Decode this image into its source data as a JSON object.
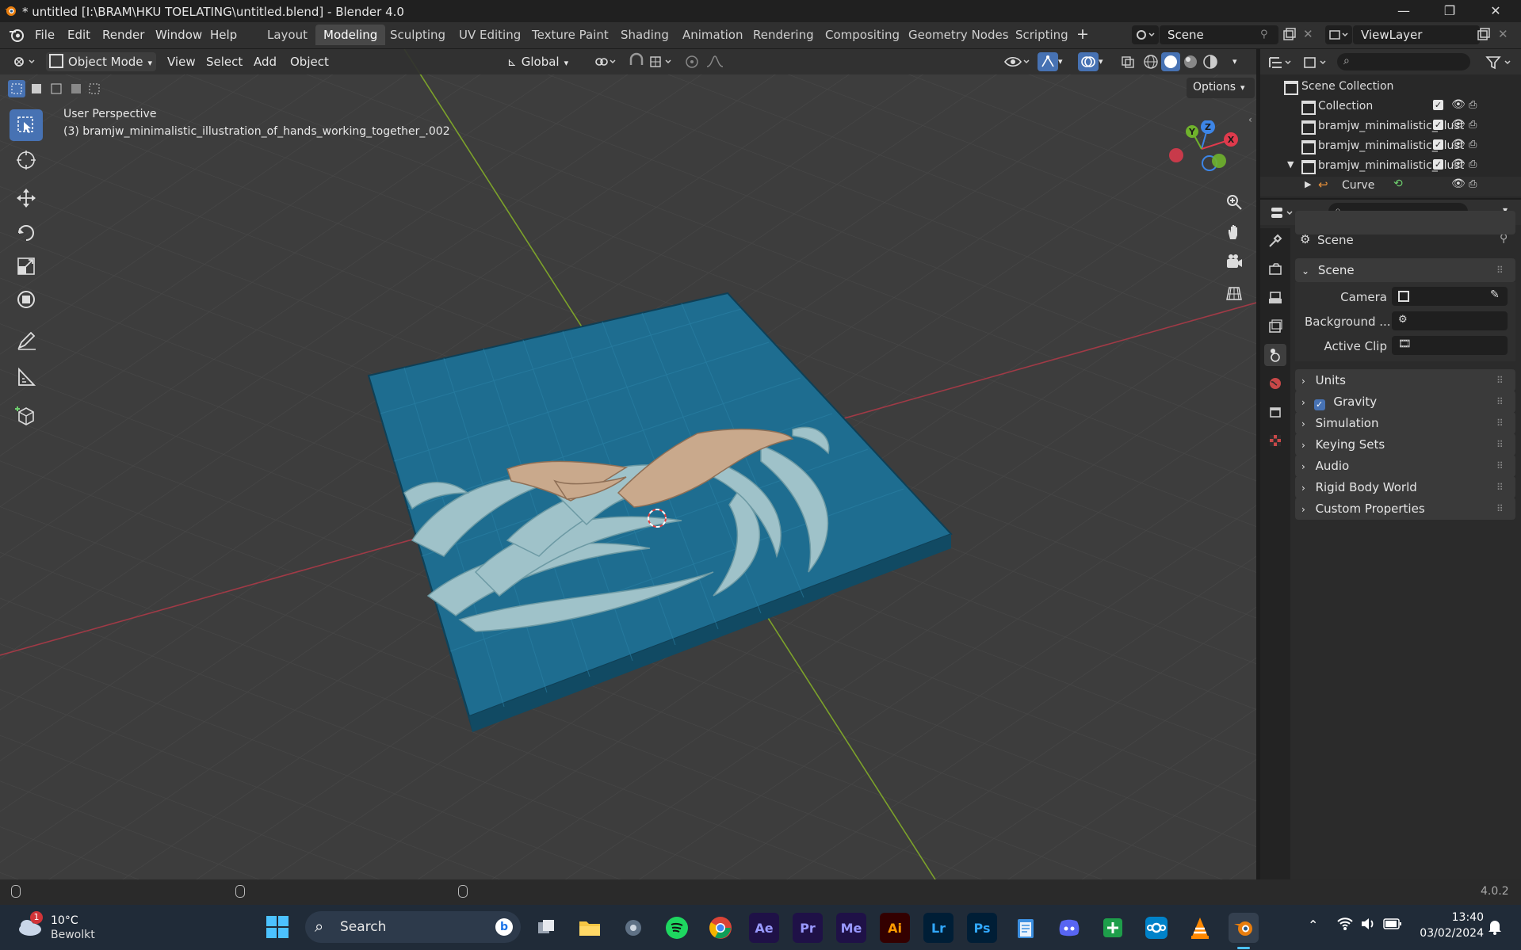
{
  "window": {
    "title": "* untitled [I:\\BRAM\\HKU TOELATING\\untitled.blend] - Blender 4.0",
    "minimize": "—",
    "maximize": "❐",
    "close": "✕"
  },
  "menu": {
    "items": [
      "File",
      "Edit",
      "Render",
      "Window",
      "Help"
    ]
  },
  "workspaces": {
    "tabs": [
      "Layout",
      "Modeling",
      "Sculpting",
      "UV Editing",
      "Texture Paint",
      "Shading",
      "Animation",
      "Rendering",
      "Compositing",
      "Geometry Nodes",
      "Scripting"
    ],
    "active": "Modeling",
    "add": "+"
  },
  "scene_selector": {
    "value": "Scene"
  },
  "viewlayer_selector": {
    "value": "ViewLayer"
  },
  "viewport": {
    "mode": "Object Mode",
    "menus": [
      "View",
      "Select",
      "Add",
      "Object"
    ],
    "orientation": "Global",
    "options_label": "Options",
    "overlay_title": "User Perspective",
    "overlay_object": "(3) bramjw_minimalistic_illustration_of_hands_working_together_.002",
    "gizmo_axes": {
      "x": "X",
      "y": "Y",
      "z": "Z"
    }
  },
  "outliner": {
    "root": "Scene Collection",
    "items": [
      {
        "label": "Collection"
      },
      {
        "label": "bramjw_minimalistic_illust"
      },
      {
        "label": "bramjw_minimalistic_illust"
      },
      {
        "label": "bramjw_minimalistic_illust"
      },
      {
        "label": "Curve"
      }
    ]
  },
  "properties": {
    "context": "Scene",
    "panel_title": "Scene",
    "fields": {
      "camera": "Camera",
      "background": "Background ...",
      "active_clip": "Active Clip"
    },
    "panels": [
      "Units",
      "Gravity",
      "Simulation",
      "Keying Sets",
      "Audio",
      "Rigid Body World",
      "Custom Properties"
    ],
    "gravity_checked": true
  },
  "statusbar": {
    "version": "4.0.2"
  },
  "taskbar": {
    "weather": {
      "temp": "10°C",
      "desc": "Bewolkt",
      "badge": "1"
    },
    "search": "Search",
    "apps": [
      {
        "name": "Ae",
        "color": "#1f1147",
        "fg": "#9999ff"
      },
      {
        "name": "Pr",
        "color": "#1f1147",
        "fg": "#9999ff"
      },
      {
        "name": "Me",
        "color": "#1f1147",
        "fg": "#9999ff"
      },
      {
        "name": "Ai",
        "color": "#330000",
        "fg": "#ff9a00"
      },
      {
        "name": "Lr",
        "color": "#001e36",
        "fg": "#31a8ff"
      },
      {
        "name": "Ps",
        "color": "#001e36",
        "fg": "#31a8ff"
      }
    ],
    "time": "13:40",
    "date": "03/02/2024"
  },
  "colors": {
    "accent": "#4772b3",
    "base_plate": "#1d6a8c",
    "waves": "#9fc2c9",
    "hands": "#c9a98c"
  }
}
